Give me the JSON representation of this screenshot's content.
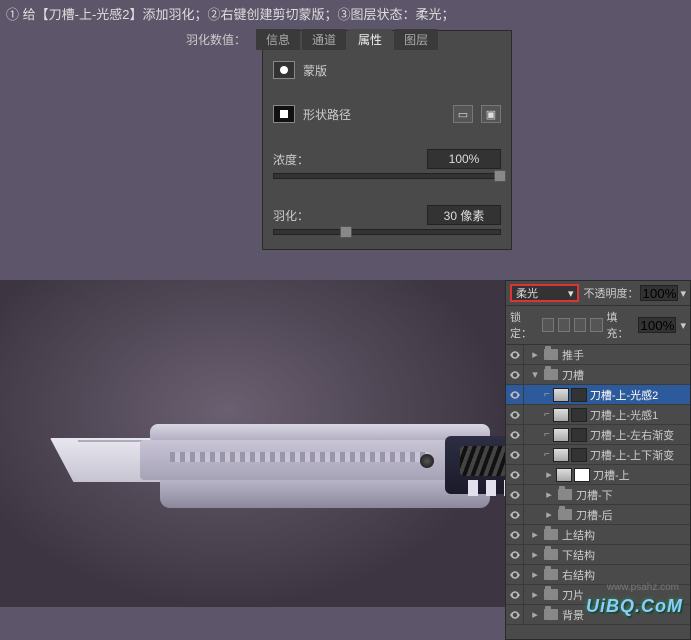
{
  "instruction": "① 给【刀槽-上-光感2】添加羽化；②右键创建剪切蒙版；③图层状态：柔光；",
  "featherLabel": "羽化数值：",
  "tabs": {
    "info": "信息",
    "channels": "通道",
    "properties": "属性",
    "layers": "图层"
  },
  "maskLabel": "蒙版",
  "shapeLabel": "形状路径",
  "densityLabel": "浓度：",
  "densityValue": "100%",
  "featherRowLabel": "羽化：",
  "featherValue": "30 像素",
  "blendMode": "柔光",
  "opacityLabel": "不透明度：",
  "opacityValue": "100%",
  "lockLabel": "锁定：",
  "fillLabel": "填充：",
  "fillValue": "100%",
  "tri": {
    "right": "▸",
    "down": "▾"
  },
  "layerRows": [
    {
      "type": "folder",
      "indent": 0,
      "open": false,
      "label": "推手"
    },
    {
      "type": "folder",
      "indent": 0,
      "open": true,
      "label": "刀槽"
    },
    {
      "type": "clip",
      "indent": 1,
      "label": "刀槽-上-光感2",
      "selected": true
    },
    {
      "type": "clip",
      "indent": 1,
      "label": "刀槽-上-光感1"
    },
    {
      "type": "clip",
      "indent": 1,
      "label": "刀槽-上-左右渐变"
    },
    {
      "type": "clip",
      "indent": 1,
      "label": "刀槽-上-上下渐变"
    },
    {
      "type": "shape",
      "indent": 1,
      "label": "刀槽-上"
    },
    {
      "type": "folder",
      "indent": 1,
      "open": false,
      "label": "刀槽-下"
    },
    {
      "type": "folder",
      "indent": 1,
      "open": false,
      "label": "刀槽-后"
    },
    {
      "type": "folder",
      "indent": 0,
      "open": false,
      "label": "上结构"
    },
    {
      "type": "folder",
      "indent": 0,
      "open": false,
      "label": "下结构"
    },
    {
      "type": "folder",
      "indent": 0,
      "open": false,
      "label": "右结构"
    },
    {
      "type": "folder",
      "indent": 0,
      "open": false,
      "label": "刀片"
    },
    {
      "type": "folder",
      "indent": 0,
      "open": false,
      "label": "背景"
    }
  ],
  "watermark": "UiBQ.CoM",
  "watermark2": "www.psahz.com"
}
